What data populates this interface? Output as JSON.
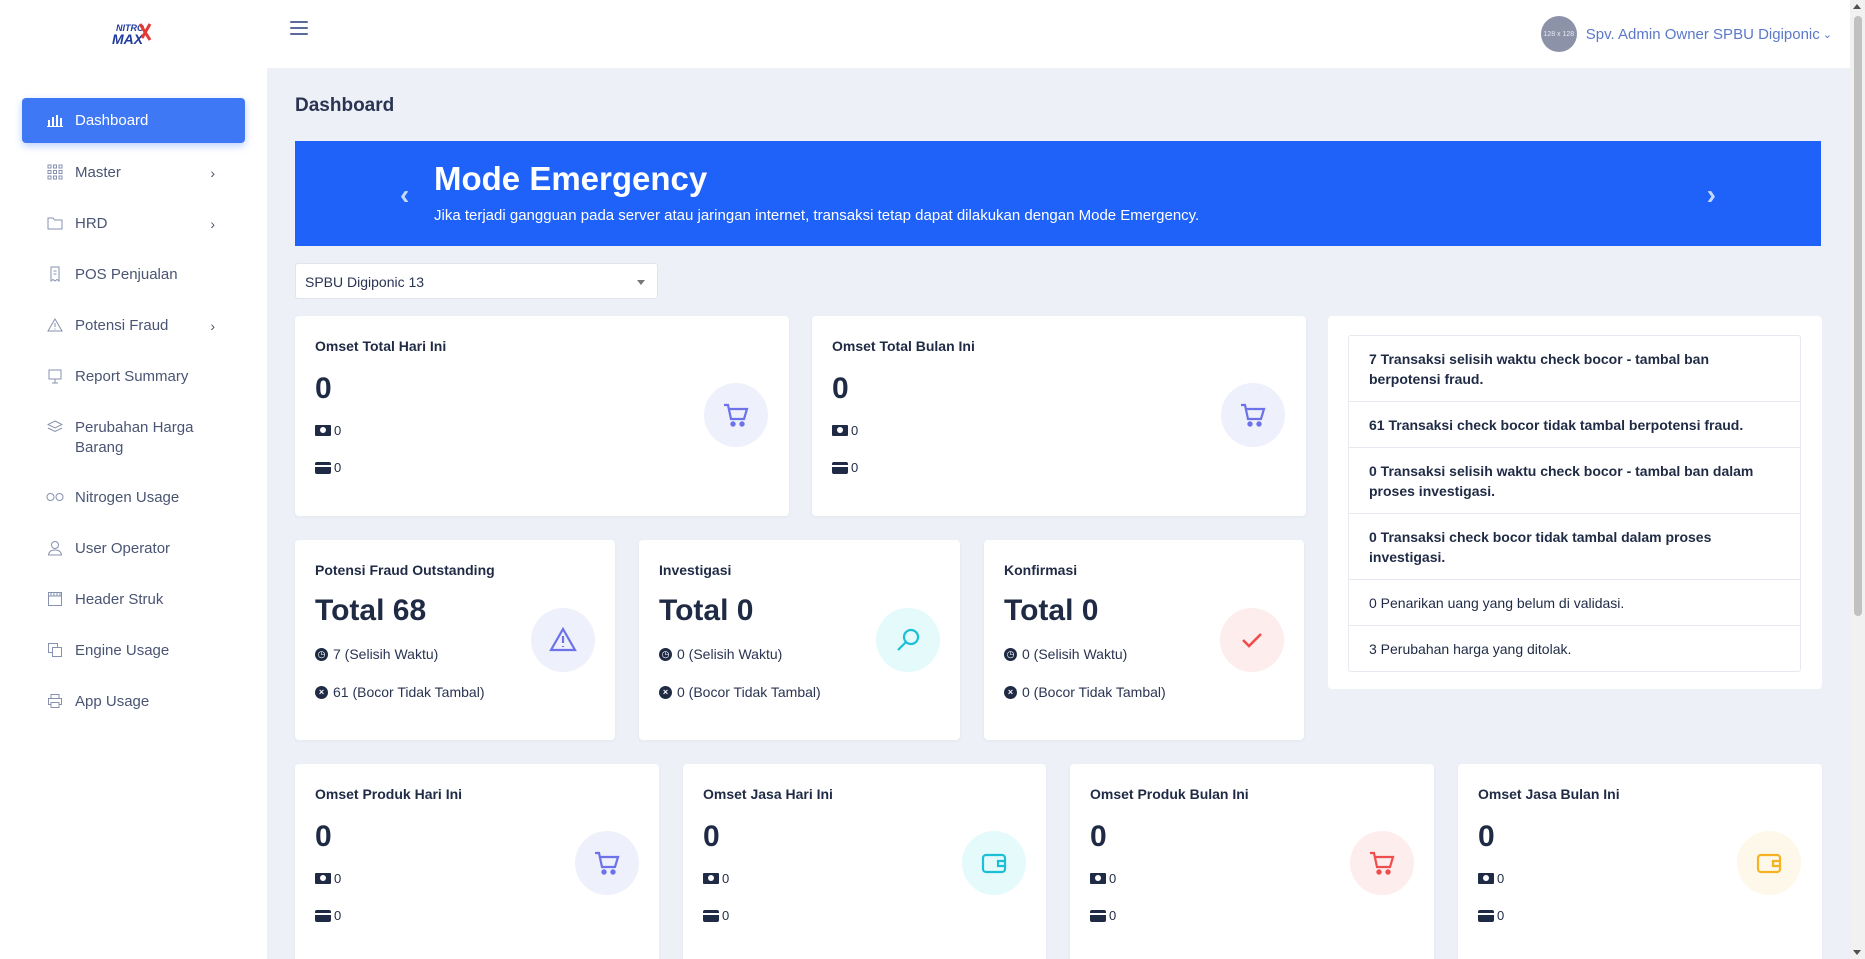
{
  "brand": {
    "logo_text_top": "NITRO",
    "logo_text_bottom": "MAX"
  },
  "sidebar": {
    "items": [
      {
        "label": "Dashboard",
        "icon": "bar-chart-icon",
        "active": true,
        "has_submenu": false
      },
      {
        "label": "Master",
        "icon": "grid-icon",
        "has_submenu": true
      },
      {
        "label": "HRD",
        "icon": "folder-icon",
        "has_submenu": true
      },
      {
        "label": "POS Penjualan",
        "icon": "receipt-icon",
        "has_submenu": false
      },
      {
        "label": "Potensi Fraud",
        "icon": "warning-icon",
        "has_submenu": true
      },
      {
        "label": "Report Summary",
        "icon": "monitor-icon",
        "has_submenu": false
      },
      {
        "label": "Perubahan Harga Barang",
        "icon": "layers-icon",
        "has_submenu": false
      },
      {
        "label": "Nitrogen Usage",
        "icon": "infinity-icon",
        "has_submenu": false
      },
      {
        "label": "User Operator",
        "icon": "user-icon",
        "has_submenu": false
      },
      {
        "label": "Header Struk",
        "icon": "calendar-icon",
        "has_submenu": false
      },
      {
        "label": "Engine Usage",
        "icon": "copy-icon",
        "has_submenu": false
      },
      {
        "label": "App Usage",
        "icon": "printer-icon",
        "has_submenu": false
      }
    ]
  },
  "topbar": {
    "user_name": "Spv. Admin Owner SPBU Digiponic",
    "avatar_text": "128 x 128"
  },
  "page": {
    "title": "Dashboard"
  },
  "banner": {
    "title": "Mode Emergency",
    "text": "Jika terjadi gangguan pada server atau jaringan internet, transaksi tetap dapat dilakukan dengan Mode Emergency.",
    "bg": "#1e62fa"
  },
  "station_select": {
    "value": "SPBU Digiponic 13"
  },
  "omset_cards": [
    {
      "title": "Omset Total Hari Ini",
      "value": "0",
      "cash": "0",
      "card": "0",
      "icon": "cart-icon",
      "color": "#6c72e8"
    },
    {
      "title": "Omset Total Bulan Ini",
      "value": "0",
      "cash": "0",
      "card": "0",
      "icon": "cart-icon",
      "color": "#6c72e8"
    }
  ],
  "fraud_cards": [
    {
      "title": "Potensi Fraud Outstanding",
      "value": "Total 68",
      "line1": "7 (Selisih Waktu)",
      "line2": "61 (Bocor Tidak Tambal)",
      "icon": "warning-icon",
      "color": "#6c72e8"
    },
    {
      "title": "Investigasi",
      "value": "Total 0",
      "line1": "0 (Selisih Waktu)",
      "line2": "0 (Bocor Tidak Tambal)",
      "icon": "search-icon",
      "color": "#1bc0d6"
    },
    {
      "title": "Konfirmasi",
      "value": "Total 0",
      "line1": "0 (Selisih Waktu)",
      "line2": "0 (Bocor Tidak Tambal)",
      "icon": "check-icon",
      "color": "#ef4e4e"
    }
  ],
  "alerts": [
    {
      "text": "7 Transaksi selisih waktu check bocor - tambal ban berpotensi fraud.",
      "bold": true
    },
    {
      "text": "61 Transaksi check bocor tidak tambal berpotensi fraud.",
      "bold": true
    },
    {
      "text": "0 Transaksi selisih waktu check bocor - tambal ban dalam proses investigasi.",
      "bold": true
    },
    {
      "text": "0 Transaksi check bocor tidak tambal dalam proses investigasi.",
      "bold": true
    },
    {
      "text": "0 Penarikan uang yang belum di validasi.",
      "bold": false
    },
    {
      "text": "3 Perubahan harga yang ditolak.",
      "bold": false
    }
  ],
  "product_cards": [
    {
      "title": "Omset Produk Hari Ini",
      "value": "0",
      "cash": "0",
      "card": "0",
      "icon": "cart-icon",
      "color": "#6c72e8"
    },
    {
      "title": "Omset Jasa Hari Ini",
      "value": "0",
      "cash": "0",
      "card": "0",
      "icon": "wallet-icon",
      "color": "#1bc0d6"
    },
    {
      "title": "Omset Produk Bulan Ini",
      "value": "0",
      "cash": "0",
      "card": "0",
      "icon": "cart-icon",
      "color": "#ef4e4e"
    },
    {
      "title": "Omset Jasa Bulan Ini",
      "value": "0",
      "cash": "0",
      "card": "0",
      "icon": "wallet-icon",
      "color": "#f5b324"
    }
  ]
}
